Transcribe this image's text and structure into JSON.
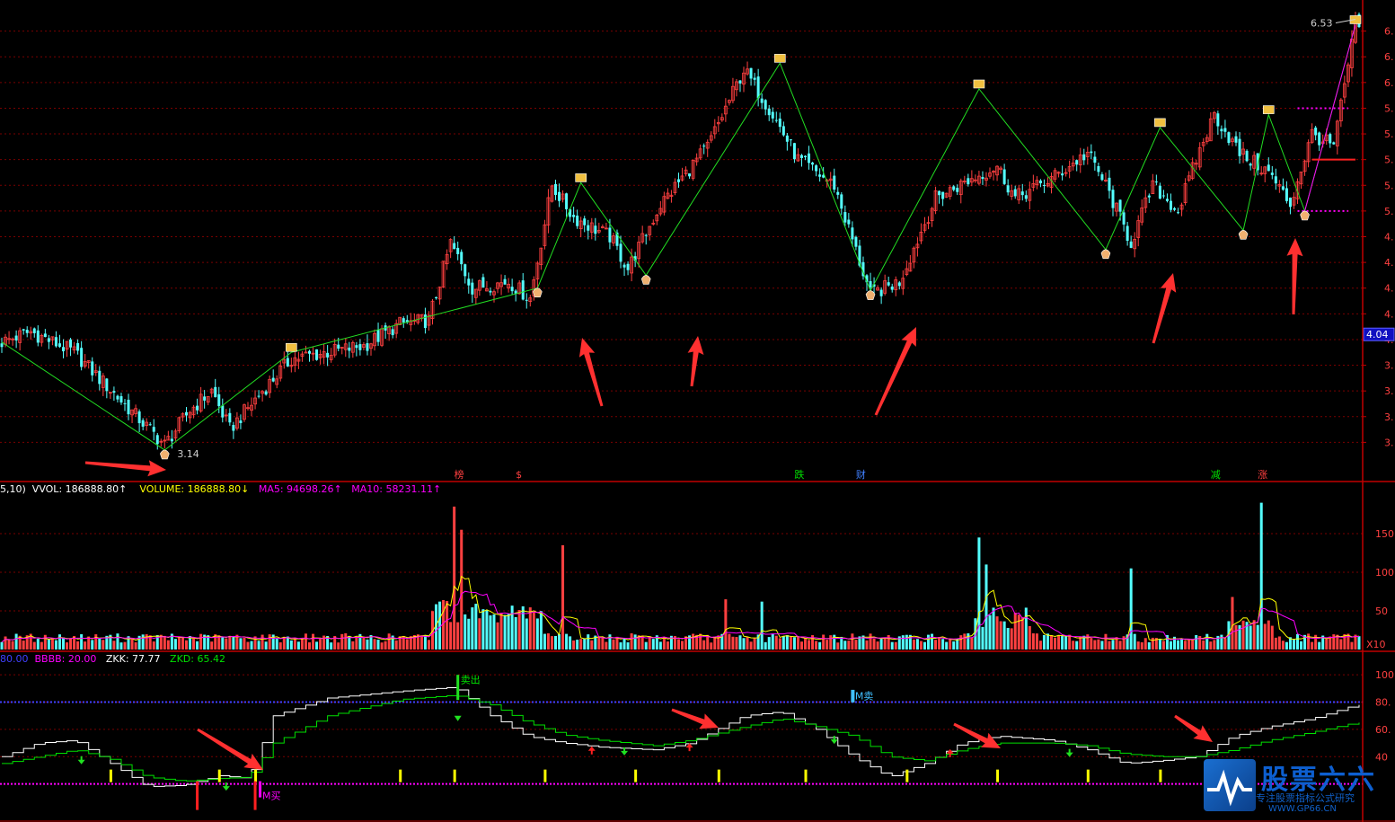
{
  "chart_data": [
    {
      "type": "candlestick",
      "panel": "price",
      "ylim": [
        3.0,
        6.6
      ],
      "yticks": [
        3.2,
        3.4,
        3.6,
        3.8,
        4.0,
        4.2,
        4.4,
        4.6,
        4.8,
        5.0,
        5.2,
        5.4,
        5.6,
        5.8,
        6.0,
        6.2,
        6.4
      ],
      "ytick_labels": [
        "3.",
        "3.",
        "3.",
        "3.",
        "4.",
        "4.",
        "4.",
        "4.",
        "4.",
        "5.",
        "5.",
        "5.",
        "5.",
        "5.",
        "6.",
        "6.",
        "6."
      ],
      "grid": true,
      "n_bars": 250,
      "close_pivots": [
        {
          "i": 0,
          "v": 3.98
        },
        {
          "i": 8,
          "v": 4.06
        },
        {
          "i": 20,
          "v": 3.9
        },
        {
          "i": 32,
          "v": 3.55
        },
        {
          "i": 45,
          "v": 3.18
        },
        {
          "i": 52,
          "v": 3.45
        },
        {
          "i": 58,
          "v": 3.6
        },
        {
          "i": 63,
          "v": 3.3
        },
        {
          "i": 72,
          "v": 3.6
        },
        {
          "i": 80,
          "v": 3.85
        },
        {
          "i": 90,
          "v": 3.9
        },
        {
          "i": 100,
          "v": 3.95
        },
        {
          "i": 110,
          "v": 4.12
        },
        {
          "i": 118,
          "v": 4.15
        },
        {
          "i": 124,
          "v": 4.75
        },
        {
          "i": 130,
          "v": 4.4
        },
        {
          "i": 140,
          "v": 4.45
        },
        {
          "i": 146,
          "v": 4.32
        },
        {
          "i": 152,
          "v": 5.2
        },
        {
          "i": 158,
          "v": 4.95
        },
        {
          "i": 168,
          "v": 4.8
        },
        {
          "i": 173,
          "v": 4.55
        },
        {
          "i": 182,
          "v": 5.05
        },
        {
          "i": 195,
          "v": 5.5
        },
        {
          "i": 205,
          "v": 6.1
        },
        {
          "i": 212,
          "v": 5.8
        },
        {
          "i": 220,
          "v": 5.4
        },
        {
          "i": 230,
          "v": 5.2
        },
        {
          "i": 240,
          "v": 4.35
        },
        {
          "i": 248,
          "v": 4.45
        },
        {
          "i": 258,
          "v": 5.1
        },
        {
          "i": 268,
          "v": 5.25
        },
        {
          "i": 275,
          "v": 5.35
        },
        {
          "i": 280,
          "v": 5.1
        },
        {
          "i": 290,
          "v": 5.25
        },
        {
          "i": 300,
          "v": 5.45
        },
        {
          "i": 305,
          "v": 5.2
        },
        {
          "i": 312,
          "v": 4.75
        },
        {
          "i": 318,
          "v": 5.2
        },
        {
          "i": 325,
          "v": 5.0
        },
        {
          "i": 330,
          "v": 5.4
        },
        {
          "i": 335,
          "v": 5.75
        },
        {
          "i": 342,
          "v": 5.45
        },
        {
          "i": 350,
          "v": 5.3
        },
        {
          "i": 356,
          "v": 5.05
        },
        {
          "i": 362,
          "v": 5.6
        },
        {
          "i": 368,
          "v": 5.5
        },
        {
          "i": 374,
          "v": 6.45
        }
      ],
      "annotations": [
        {
          "text": "3.14",
          "kind": "low"
        },
        {
          "text": "6.53",
          "kind": "high"
        },
        {
          "text": "4.04",
          "kind": "current-price"
        }
      ],
      "zigzag_pivots": [
        {
          "i": 0,
          "v": 3.98
        },
        {
          "i": 45,
          "v": 3.14
        },
        {
          "i": 80,
          "v": 3.9
        },
        {
          "i": 148,
          "v": 4.4
        },
        {
          "i": 160,
          "v": 5.22
        },
        {
          "i": 178,
          "v": 4.5
        },
        {
          "i": 215,
          "v": 6.15
        },
        {
          "i": 240,
          "v": 4.38
        },
        {
          "i": 270,
          "v": 5.95
        },
        {
          "i": 305,
          "v": 4.7
        },
        {
          "i": 320,
          "v": 5.65
        },
        {
          "i": 343,
          "v": 4.85
        },
        {
          "i": 350,
          "v": 5.75
        },
        {
          "i": 360,
          "v": 5.0
        },
        {
          "i": 374,
          "v": 6.45
        }
      ],
      "event_markers": [
        {
          "text": "榜",
          "color": "#ff4040",
          "i": 125
        },
        {
          "text": "$",
          "color": "#ff4040",
          "i": 142
        },
        {
          "text": "跌",
          "color": "#00e000",
          "i": 219
        },
        {
          "text": "财",
          "color": "#4080ff",
          "i": 236
        },
        {
          "text": "减",
          "color": "#00e000",
          "i": 334
        },
        {
          "text": "涨",
          "color": "#ff4040",
          "i": 347
        }
      ]
    },
    {
      "type": "bar",
      "panel": "volume",
      "header": [
        {
          "text": "5,10)",
          "color": "#ffffff"
        },
        {
          "text": "VVOL: 186888.80↑",
          "color": "#ffffff"
        },
        {
          "text": "VOLUME: 186888.80↓",
          "color": "#ffff00"
        },
        {
          "text": "MA5: 94698.26↑",
          "color": "#ff00ff"
        },
        {
          "text": "MA10: 58231.11↑",
          "color": "#ff00ff"
        }
      ],
      "ylim": [
        0,
        2000
      ],
      "yticks": [
        500,
        1000,
        1500
      ],
      "ytick_labels": [
        "50",
        "100",
        "150"
      ],
      "unit_label": "X10",
      "spikes": [
        {
          "i": 125,
          "v": 1850
        },
        {
          "i": 127,
          "v": 1550
        },
        {
          "i": 155,
          "v": 1350
        },
        {
          "i": 200,
          "v": 650
        },
        {
          "i": 210,
          "v": 620
        },
        {
          "i": 270,
          "v": 1450
        },
        {
          "i": 272,
          "v": 1100
        },
        {
          "i": 312,
          "v": 1050
        },
        {
          "i": 340,
          "v": 680
        },
        {
          "i": 348,
          "v": 1900
        }
      ]
    },
    {
      "type": "line",
      "panel": "oscillator",
      "header": [
        {
          "text": "80.00",
          "color": "#4040ff"
        },
        {
          "text": "BBBB: 20.00",
          "color": "#ff00ff"
        },
        {
          "text": "ZKK: 77.77",
          "color": "#ffffff"
        },
        {
          "text": "ZKD: 65.42",
          "color": "#00e000"
        }
      ],
      "ylim": [
        0,
        110
      ],
      "yticks": [
        40,
        60,
        80,
        100
      ],
      "ytick_labels": [
        "40",
        "60.",
        "80.",
        "100"
      ],
      "reference_lines": [
        {
          "v": 80,
          "color": "#4040ff"
        },
        {
          "v": 20,
          "color": "#ff00ff"
        }
      ],
      "series": [
        {
          "color": "#ffffff",
          "points": [
            {
              "i": 0,
              "v": 40
            },
            {
              "i": 10,
              "v": 50
            },
            {
              "i": 20,
              "v": 52
            },
            {
              "i": 30,
              "v": 35
            },
            {
              "i": 40,
              "v": 18
            },
            {
              "i": 50,
              "v": 19
            },
            {
              "i": 60,
              "v": 26
            },
            {
              "i": 68,
              "v": 24
            },
            {
              "i": 75,
              "v": 70
            },
            {
              "i": 90,
              "v": 83
            },
            {
              "i": 110,
              "v": 88
            },
            {
              "i": 125,
              "v": 91
            },
            {
              "i": 135,
              "v": 70
            },
            {
              "i": 145,
              "v": 55
            },
            {
              "i": 155,
              "v": 50
            },
            {
              "i": 165,
              "v": 47
            },
            {
              "i": 180,
              "v": 45
            },
            {
              "i": 190,
              "v": 50
            },
            {
              "i": 205,
              "v": 70
            },
            {
              "i": 215,
              "v": 73
            },
            {
              "i": 225,
              "v": 60
            },
            {
              "i": 235,
              "v": 40
            },
            {
              "i": 245,
              "v": 25
            },
            {
              "i": 255,
              "v": 35
            },
            {
              "i": 265,
              "v": 50
            },
            {
              "i": 275,
              "v": 55
            },
            {
              "i": 290,
              "v": 52
            },
            {
              "i": 300,
              "v": 45
            },
            {
              "i": 310,
              "v": 35
            },
            {
              "i": 320,
              "v": 37
            },
            {
              "i": 330,
              "v": 40
            },
            {
              "i": 340,
              "v": 55
            },
            {
              "i": 350,
              "v": 62
            },
            {
              "i": 362,
              "v": 68
            },
            {
              "i": 374,
              "v": 78
            }
          ]
        },
        {
          "color": "#00e000",
          "points": [
            {
              "i": 0,
              "v": 35
            },
            {
              "i": 10,
              "v": 40
            },
            {
              "i": 20,
              "v": 45
            },
            {
              "i": 30,
              "v": 38
            },
            {
              "i": 40,
              "v": 25
            },
            {
              "i": 50,
              "v": 22
            },
            {
              "i": 60,
              "v": 24
            },
            {
              "i": 68,
              "v": 25
            },
            {
              "i": 75,
              "v": 50
            },
            {
              "i": 90,
              "v": 70
            },
            {
              "i": 110,
              "v": 82
            },
            {
              "i": 125,
              "v": 85
            },
            {
              "i": 135,
              "v": 78
            },
            {
              "i": 145,
              "v": 65
            },
            {
              "i": 155,
              "v": 56
            },
            {
              "i": 165,
              "v": 52
            },
            {
              "i": 180,
              "v": 48
            },
            {
              "i": 190,
              "v": 52
            },
            {
              "i": 205,
              "v": 62
            },
            {
              "i": 215,
              "v": 68
            },
            {
              "i": 225,
              "v": 62
            },
            {
              "i": 235,
              "v": 55
            },
            {
              "i": 245,
              "v": 40
            },
            {
              "i": 255,
              "v": 37
            },
            {
              "i": 265,
              "v": 45
            },
            {
              "i": 275,
              "v": 50
            },
            {
              "i": 290,
              "v": 50
            },
            {
              "i": 300,
              "v": 48
            },
            {
              "i": 310,
              "v": 42
            },
            {
              "i": 320,
              "v": 40
            },
            {
              "i": 330,
              "v": 40
            },
            {
              "i": 340,
              "v": 45
            },
            {
              "i": 350,
              "v": 52
            },
            {
              "i": 362,
              "v": 58
            },
            {
              "i": 374,
              "v": 65
            }
          ]
        }
      ],
      "signals": [
        {
          "text": "卖出",
          "color": "#00e000",
          "i": 126
        },
        {
          "text": "M卖",
          "color": "#40c0ff",
          "i": 235
        },
        {
          "text": "M买",
          "color": "#ff00ff",
          "i": 70
        }
      ]
    }
  ],
  "watermark": {
    "title": "股票六六",
    "subtitle": "专注股票指标公式研究",
    "url": "WWW.GP66.CN"
  }
}
